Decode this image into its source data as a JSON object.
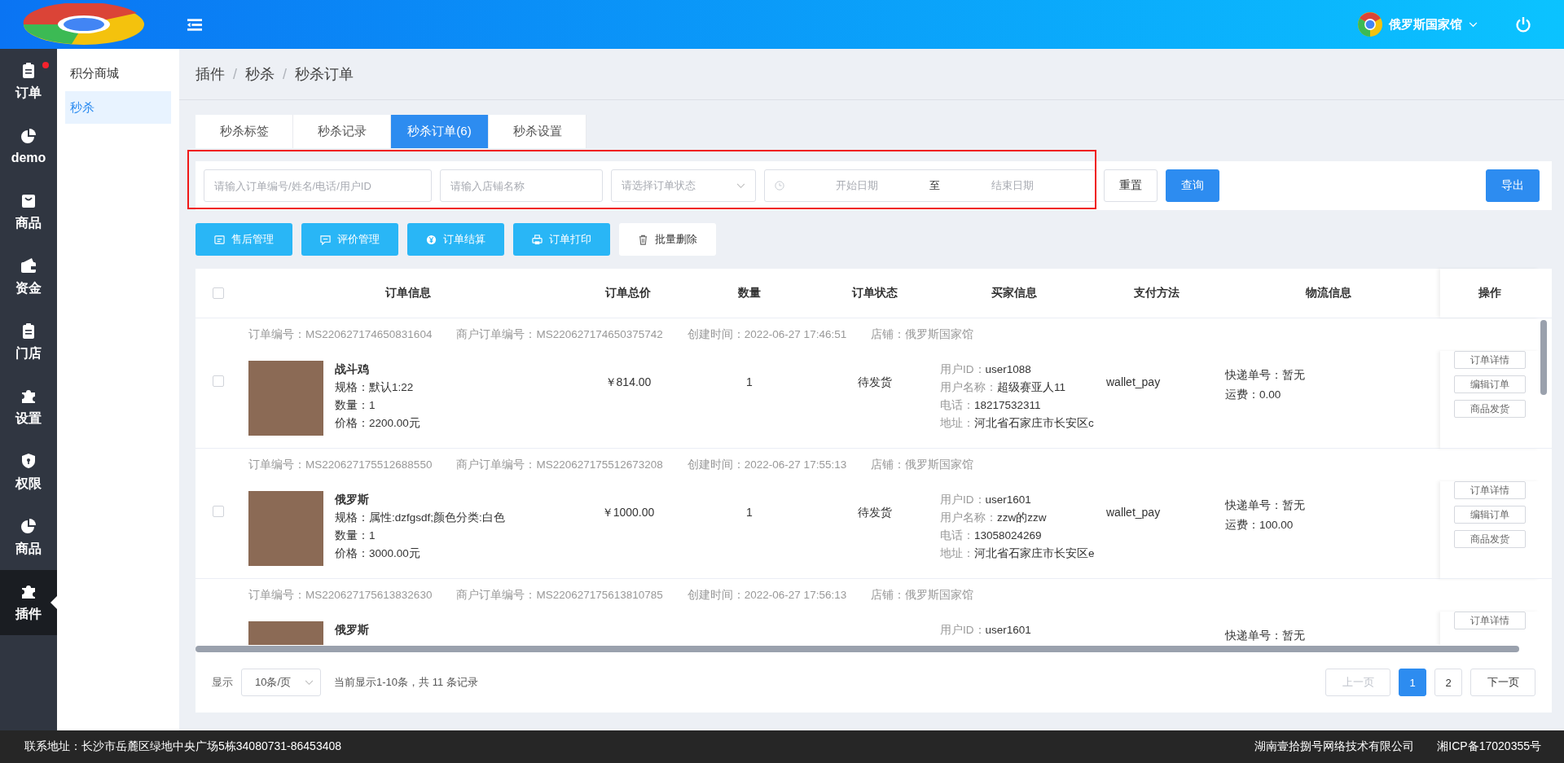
{
  "header": {
    "user_name": "俄罗斯国家馆"
  },
  "nav": [
    {
      "label": "订单",
      "selected": false,
      "notice": true
    },
    {
      "label": "demo",
      "selected": false,
      "notice": false
    },
    {
      "label": "商品",
      "selected": false,
      "notice": false
    },
    {
      "label": "资金",
      "selected": false,
      "notice": false
    },
    {
      "label": "门店",
      "selected": false,
      "notice": false
    },
    {
      "label": "设置",
      "selected": false,
      "notice": false
    },
    {
      "label": "权限",
      "selected": false,
      "notice": false
    },
    {
      "label": "商品",
      "selected": false,
      "notice": false
    },
    {
      "label": "插件",
      "selected": true,
      "notice": false
    }
  ],
  "submenu": [
    {
      "label": "积分商城",
      "selected": false
    },
    {
      "label": "秒杀",
      "selected": true
    }
  ],
  "breadcrumb": {
    "items": [
      "插件",
      "秒杀",
      "秒杀订单"
    ],
    "separator": "/"
  },
  "tabs": [
    {
      "label": "秒杀标签",
      "selected": false
    },
    {
      "label": "秒杀记录",
      "selected": false
    },
    {
      "label": "秒杀订单(6)",
      "selected": true
    },
    {
      "label": "秒杀设置",
      "selected": false
    }
  ],
  "filters": {
    "highlighted": true,
    "keyword": {
      "placeholder": "请输入订单编号/姓名/电话/用户ID"
    },
    "shop": {
      "placeholder": "请输入店铺名称"
    },
    "status": {
      "placeholder": "请选择订单状态"
    },
    "date_range": {
      "start_placeholder": "开始日期",
      "separator": "至",
      "end_placeholder": "结束日期"
    },
    "reset": "重置",
    "search": "查询",
    "export": "导出"
  },
  "actions": [
    {
      "label": "售后管理",
      "kind": "primary"
    },
    {
      "label": "评价管理",
      "kind": "primary"
    },
    {
      "label": "订单结算",
      "kind": "primary"
    },
    {
      "label": "订单打印",
      "kind": "primary"
    },
    {
      "label": "批量删除",
      "kind": "plain"
    }
  ],
  "table": {
    "all_checked": false,
    "columns": [
      "订单信息",
      "订单总价",
      "数量",
      "订单状态",
      "买家信息",
      "支付方法",
      "物流信息",
      "操作"
    ],
    "rows": [
      {
        "checked": false,
        "order_no": "订单编号：MS220627174650831604",
        "merchant_no": "商户订单编号：MS220627174650375742",
        "created": "创建时间：2022-06-27 17:46:51",
        "shop": "店铺：俄罗斯国家馆",
        "product": {
          "name": "战斗鸡",
          "lines": [
            "规格：默认1:22",
            "数量：1",
            "价格：2200.00元"
          ]
        },
        "price": "￥814.00",
        "quantity": "1",
        "status": "待发货",
        "buyer": [
          {
            "label": "用户ID：",
            "value": "user1088"
          },
          {
            "label": "用户名称：",
            "value": "超级赛亚人11"
          },
          {
            "label": "电话：",
            "value": "18217532311"
          },
          {
            "label": "地址：",
            "value": "河北省石家庄市长安区c"
          }
        ],
        "payment": "wallet_pay",
        "logistics": [
          "快递单号：暂无",
          "运费：0.00"
        ],
        "operations": [
          "订单详情",
          "编辑订单",
          "商品发货"
        ]
      },
      {
        "checked": false,
        "order_no": "订单编号：MS220627175512688550",
        "merchant_no": "商户订单编号：MS220627175512673208",
        "created": "创建时间：2022-06-27 17:55:13",
        "shop": "店铺：俄罗斯国家馆",
        "product": {
          "name": "俄罗斯",
          "lines": [
            "规格：属性:dzfgsdf;颜色分类:白色",
            "数量：1",
            "价格：3000.00元"
          ]
        },
        "price": "￥1000.00",
        "quantity": "1",
        "status": "待发货",
        "buyer": [
          {
            "label": "用户ID：",
            "value": "user1601"
          },
          {
            "label": "用户名称：",
            "value": "zzw的zzw"
          },
          {
            "label": "电话：",
            "value": "13058024269"
          },
          {
            "label": "地址：",
            "value": "河北省石家庄市长安区e"
          }
        ],
        "payment": "wallet_pay",
        "logistics": [
          "快递单号：暂无",
          "运费：100.00"
        ],
        "operations": [
          "订单详情",
          "编辑订单",
          "商品发货"
        ]
      },
      {
        "order_no": "订单编号：MS220627175613832630",
        "merchant_no": "商户订单编号：MS220627175613810785",
        "created": "创建时间：2022-06-27 17:56:13",
        "shop": "店铺：俄罗斯国家馆",
        "product": {
          "name": "俄罗斯"
        },
        "buyer": [
          {
            "label": "用户ID：",
            "value": "user1601"
          }
        ],
        "logistics": [
          "快递单号：暂无"
        ],
        "operations": [
          "订单详情"
        ]
      }
    ]
  },
  "pagination": {
    "show_label": "显示",
    "page_size": "10条/页",
    "summary": "当前显示1-10条，共 11 条记录",
    "prev": {
      "label": "上一页",
      "disabled": true
    },
    "pages": [
      {
        "label": "1",
        "selected": true
      },
      {
        "label": "2",
        "selected": false
      }
    ],
    "next": {
      "label": "下一页",
      "disabled": false
    }
  },
  "footer": {
    "address": "联系地址：长沙市岳麓区绿地中央广场5栋34080731-86453408",
    "company": "湖南壹拾捌号网络技术有限公司",
    "icp": "湘ICP备17020355号"
  }
}
